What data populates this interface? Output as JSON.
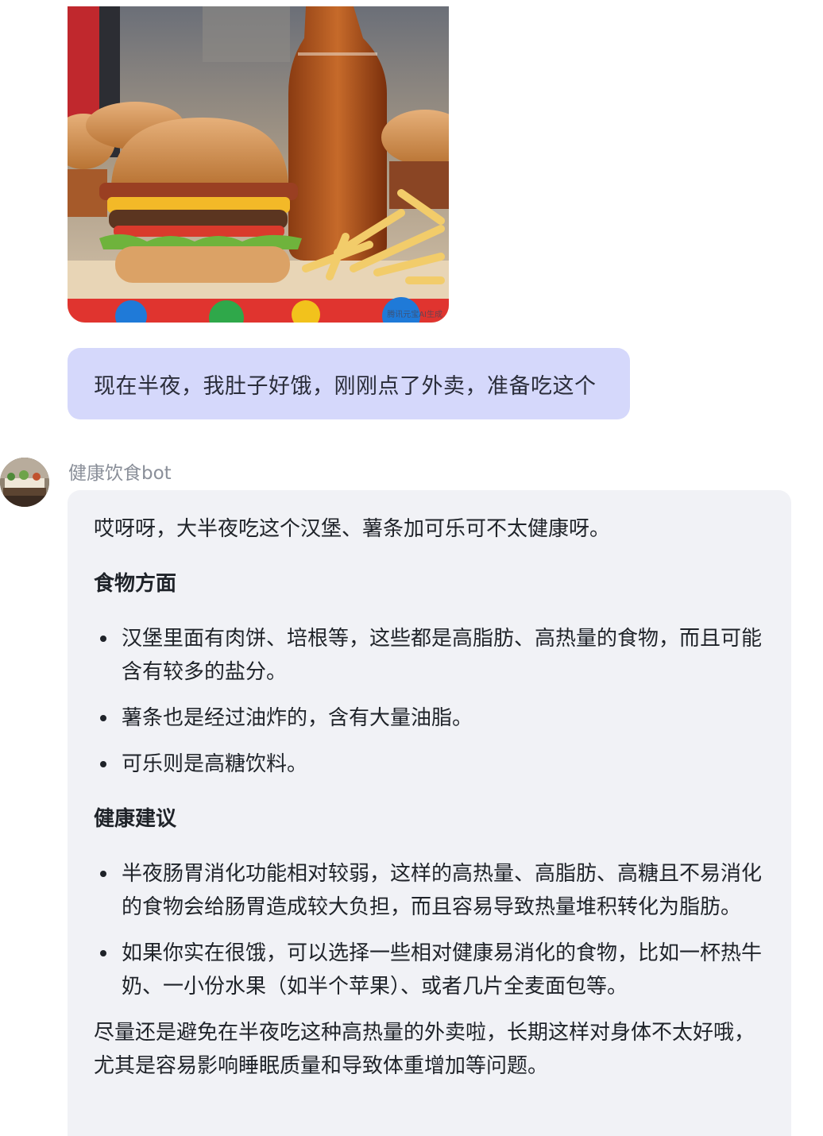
{
  "image": {
    "description_icon": "food-photo-burgers-fries-cola",
    "watermark": "腾讯元宝AI生成"
  },
  "user_message": {
    "text": "现在半夜，我肚子好饿，刚刚点了外卖，准备吃这个"
  },
  "bot": {
    "name": "健康饮食bot",
    "intro": "哎呀呀，大半夜吃这个汉堡、薯条加可乐可不太健康呀。",
    "section1": {
      "title": "食物方面",
      "items": [
        "汉堡里面有肉饼、培根等，这些都是高脂肪、高热量的食物，而且可能含有较多的盐分。",
        "薯条也是经过油炸的，含有大量油脂。",
        "可乐则是高糖饮料。"
      ]
    },
    "section2": {
      "title": "健康建议",
      "items": [
        "半夜肠胃消化功能相对较弱，这样的高热量、高脂肪、高糖且不易消化的食物会给肠胃造成较大负担，而且容易导致热量堆积转化为脂肪。",
        "如果你实在很饿，可以选择一些相对健康易消化的食物，比如一杯热牛奶、一小份水果（如半个苹果）、或者几片全麦面包等。"
      ]
    },
    "closing": "尽量还是避免在半夜吃这种高热量的外卖啦，长期这样对身体不太好哦，尤其是容易影响睡眠质量和导致体重增加等问题。"
  },
  "colors": {
    "user_bubble": "#d5d8fb",
    "bot_bubble": "#f1f2f6",
    "name_gray": "#8a8f99"
  }
}
